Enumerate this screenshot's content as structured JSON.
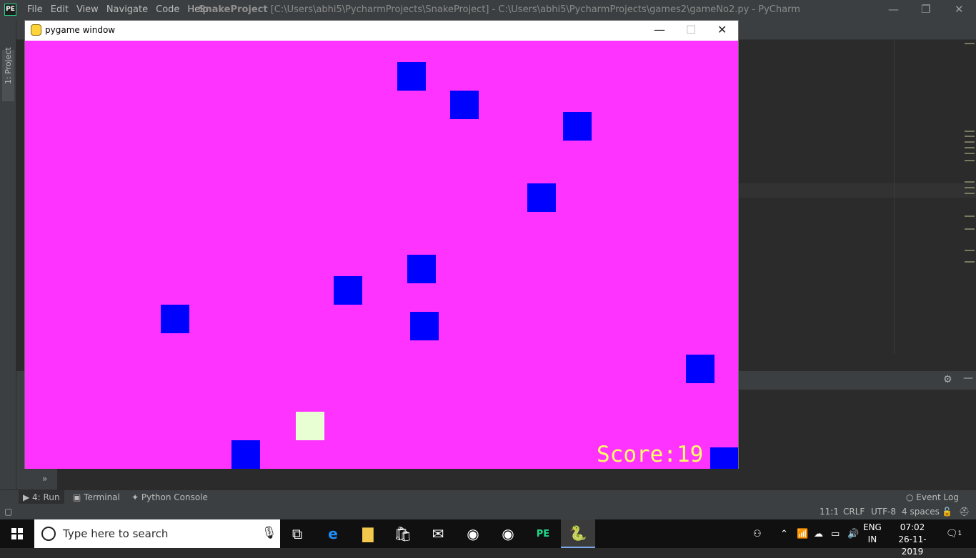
{
  "ide": {
    "logo": "PE",
    "menu": [
      "File",
      "Edit",
      "View",
      "Navigate",
      "Code",
      "Help"
    ],
    "project_name": "SnakeProject",
    "title_path": "[C:\\Users\\abhi5\\PycharmProjects\\SnakeProject] - C:\\Users\\abhi5\\PycharmProjects\\games2\\gameNo2.py - PyCharm",
    "side_tab": "1: Project",
    "tool_windows": {
      "run": "4: Run",
      "terminal": "Terminal",
      "python_console": "Python Console",
      "event_log": "Event Log"
    },
    "status": {
      "position": "11:1",
      "line_sep": "CRLF",
      "encoding": "UTF-8",
      "indent": "4 spaces"
    }
  },
  "pygame": {
    "title": "pygame window",
    "score_text": "Score:19",
    "background_color": "#ff33ff",
    "obstacle_color": "#0000ff",
    "food_color": "#e8ffd4"
  },
  "taskbar": {
    "search_placeholder": "Type here to search",
    "lang_top": "ENG",
    "lang_bottom": "IN",
    "time": "07:02",
    "date": "26-11-2019",
    "notifications": "1"
  }
}
